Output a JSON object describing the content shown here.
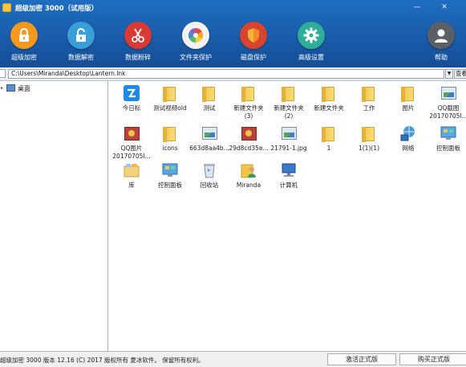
{
  "window": {
    "title": "超级加密 3000（试用版）",
    "minimize": "—",
    "close": "✕"
  },
  "toolbar": {
    "items": [
      {
        "label": "超级加密",
        "icon": "lock-icon",
        "color": "#f39a1e"
      },
      {
        "label": "数据解密",
        "icon": "unlock-icon",
        "color": "#3a9fd9"
      },
      {
        "label": "数据粉碎",
        "icon": "scissors-icon",
        "color": "#d93a35"
      },
      {
        "label": "文件夹保护",
        "icon": "pinwheel-icon",
        "color": "#f2f2f2"
      },
      {
        "label": "磁盘保护",
        "icon": "shield-icon",
        "color": "#d9442f"
      },
      {
        "label": "高级设置",
        "icon": "gear-icon",
        "color": "#2eae9a"
      },
      {
        "label": "帮助",
        "icon": "user-icon",
        "color": "#5b5f66"
      }
    ]
  },
  "address": {
    "path": "C:\\Users\\Miranda\\Desktop\\Lantern.lnk",
    "go_label": "查看"
  },
  "tree": {
    "expand_glyph": "▸",
    "root_label": "桌面"
  },
  "files": [
    {
      "name": "今日标",
      "icon": "app-blue-icon"
    },
    {
      "name": "测试视频old",
      "icon": "folder-icon"
    },
    {
      "name": "测试",
      "icon": "folder-icon"
    },
    {
      "name": "新建文件夹\n(3)",
      "icon": "folder-icon"
    },
    {
      "name": "新建文件夹\n(2)",
      "icon": "folder-icon"
    },
    {
      "name": "新建文件夹",
      "icon": "folder-icon"
    },
    {
      "name": "工作",
      "icon": "folder-icon"
    },
    {
      "name": "图片",
      "icon": "folder-icon"
    },
    {
      "name": "QQ截图\n20170705l...",
      "icon": "image-icon"
    },
    {
      "name": "QQ图片\n20170705l...",
      "icon": "photo-icon"
    },
    {
      "name": "icons",
      "icon": "folder-icon"
    },
    {
      "name": "663d8aa4b...",
      "icon": "image-icon"
    },
    {
      "name": "29d8cd35e...",
      "icon": "photo-icon"
    },
    {
      "name": "21791-1.jpg",
      "icon": "image-icon"
    },
    {
      "name": "1",
      "icon": "folder-icon"
    },
    {
      "name": "1(1)(1)",
      "icon": "folder-icon"
    },
    {
      "name": "网络",
      "icon": "network-icon"
    },
    {
      "name": "控制面板",
      "icon": "control-panel-icon"
    },
    {
      "name": "库",
      "icon": "library-icon"
    },
    {
      "name": "控制面板",
      "icon": "control-panel-icon"
    },
    {
      "name": "回收站",
      "icon": "recycle-bin-icon"
    },
    {
      "name": "Miranda",
      "icon": "user-folder-icon"
    },
    {
      "name": "计算机",
      "icon": "computer-icon"
    }
  ],
  "status": {
    "text": "超级加密 3000  版本 12.16 (C) 2017 版权所有 夏冰软件。 保留所有权利。",
    "activate_label": "激活正式版",
    "buy_label": "购买正式版"
  }
}
